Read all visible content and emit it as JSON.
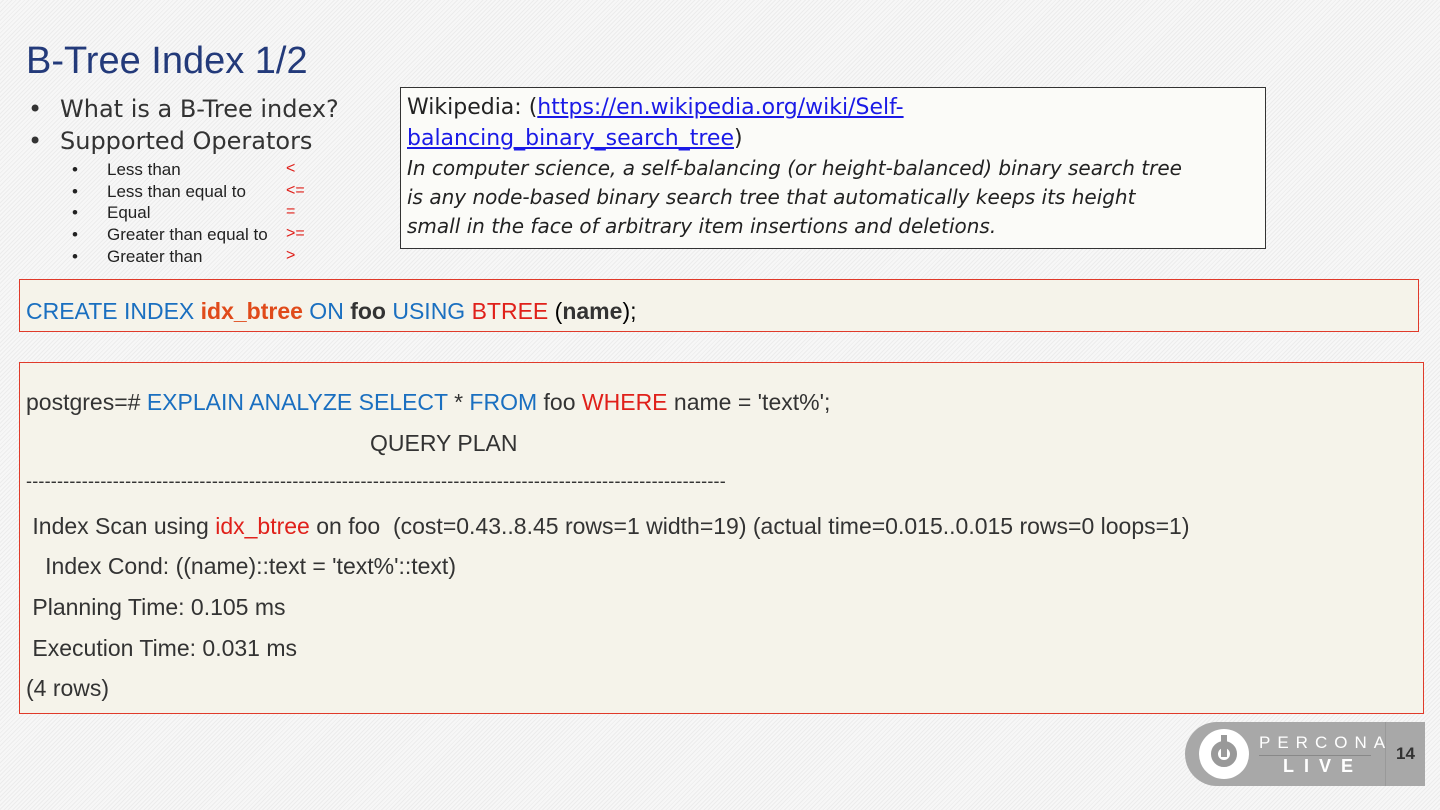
{
  "title": "B-Tree Index 1/2",
  "bullets": [
    "What is a B-Tree index?",
    "Supported Operators"
  ],
  "operators": [
    {
      "label": "Less than",
      "symbol": "<"
    },
    {
      "label": "Less than equal to",
      "symbol": "<="
    },
    {
      "label": "Equal",
      "symbol": "="
    },
    {
      "label": "Greater than equal to",
      "symbol": ">="
    },
    {
      "label": "Greater than",
      "symbol": ">"
    }
  ],
  "wiki": {
    "prefix": "Wikipedia: (",
    "link1": "https://en.wikipedia.org/wiki/Self-",
    "link2": "balancing_binary_search_tree",
    "suffix": ")",
    "lines": [
      "In computer science, a self-balancing (or height-balanced) binary search tree",
      "is any node-based binary search tree that automatically keeps its height",
      "small in the face of arbitrary item insertions and deletions."
    ]
  },
  "create": [
    "CREATE INDEX ",
    "idx_btree",
    " ON ",
    "foo",
    " USING ",
    "BTREE",
    " (",
    "name",
    ");"
  ],
  "plan": {
    "query": [
      "postgres=# ",
      "EXPLAIN ANALYZE SELECT",
      " * ",
      "FROM",
      " foo ",
      "WHERE",
      " name = 'text%';"
    ],
    "header": "QUERY PLAN",
    "divider": "-----------------------------------------------------------------------------------------------------------------",
    "scan": [
      " Index Scan using ",
      "idx_btree",
      " on foo  (cost=0.43..8.45 rows=1 width=19) (actual time=0.015..0.015 rows=0 loops=1)"
    ],
    "cond": "   Index Cond: ((name)::text = 'text%'::text)",
    "planning": " Planning Time: 0.105 ms",
    "execution": " Execution Time: 0.031 ms",
    "rows": "(4 rows)"
  },
  "footer": {
    "brand1": "PERCONA",
    "brand2": "LIVE",
    "page": "14"
  }
}
